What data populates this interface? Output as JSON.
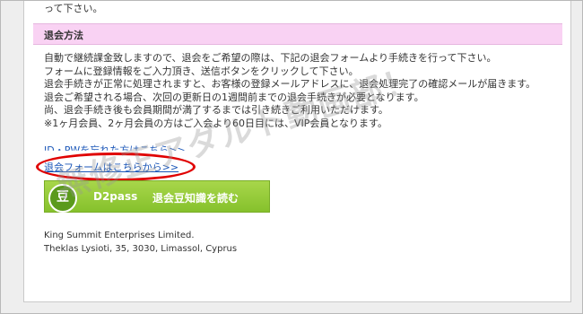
{
  "header": {
    "top_text": "って下さい。",
    "section_title": "退会方法"
  },
  "body_lines": [
    "自動で継続課金致しますので、退会をご希望の際は、下記の退会フォームより手続きを行って下さい。",
    "フォームに登録情報をご入力頂き、送信ボタンをクリックして下さい。",
    "退会手続きが正常に処理されますと、お客様の登録メールアドレスに、退会処理完了の確認メールが届きます。",
    "退会ご希望される場合、次回の更新日の1週間前までの退会手続きが必要となります。",
    "尚、退会手続き後も会員期間が満了するまでは引き続きご利用いただけます。",
    "※1ヶ月会員、2ヶ月会員の方はご入会より60日目には、VIP会員となります。"
  ],
  "links": {
    "id_password": "ID・PWを忘れた方はこちら>>",
    "quit_form": "退会フォームはこちらから>>"
  },
  "banner": {
    "icon_char": "豆",
    "brand": "D2pass",
    "label": "退会豆知識を読む"
  },
  "company": {
    "name": "King Summit Enterprises Limited.",
    "address": "Theklas Lysioti, 35, 3030, Limassol, Cyprus"
  },
  "watermark": "無修正アダルト動画部！",
  "colors": {
    "section_bg": "#f9d2f3",
    "link": "#1a56b8",
    "highlight": "#e00000",
    "banner_green": "#86c12c"
  }
}
